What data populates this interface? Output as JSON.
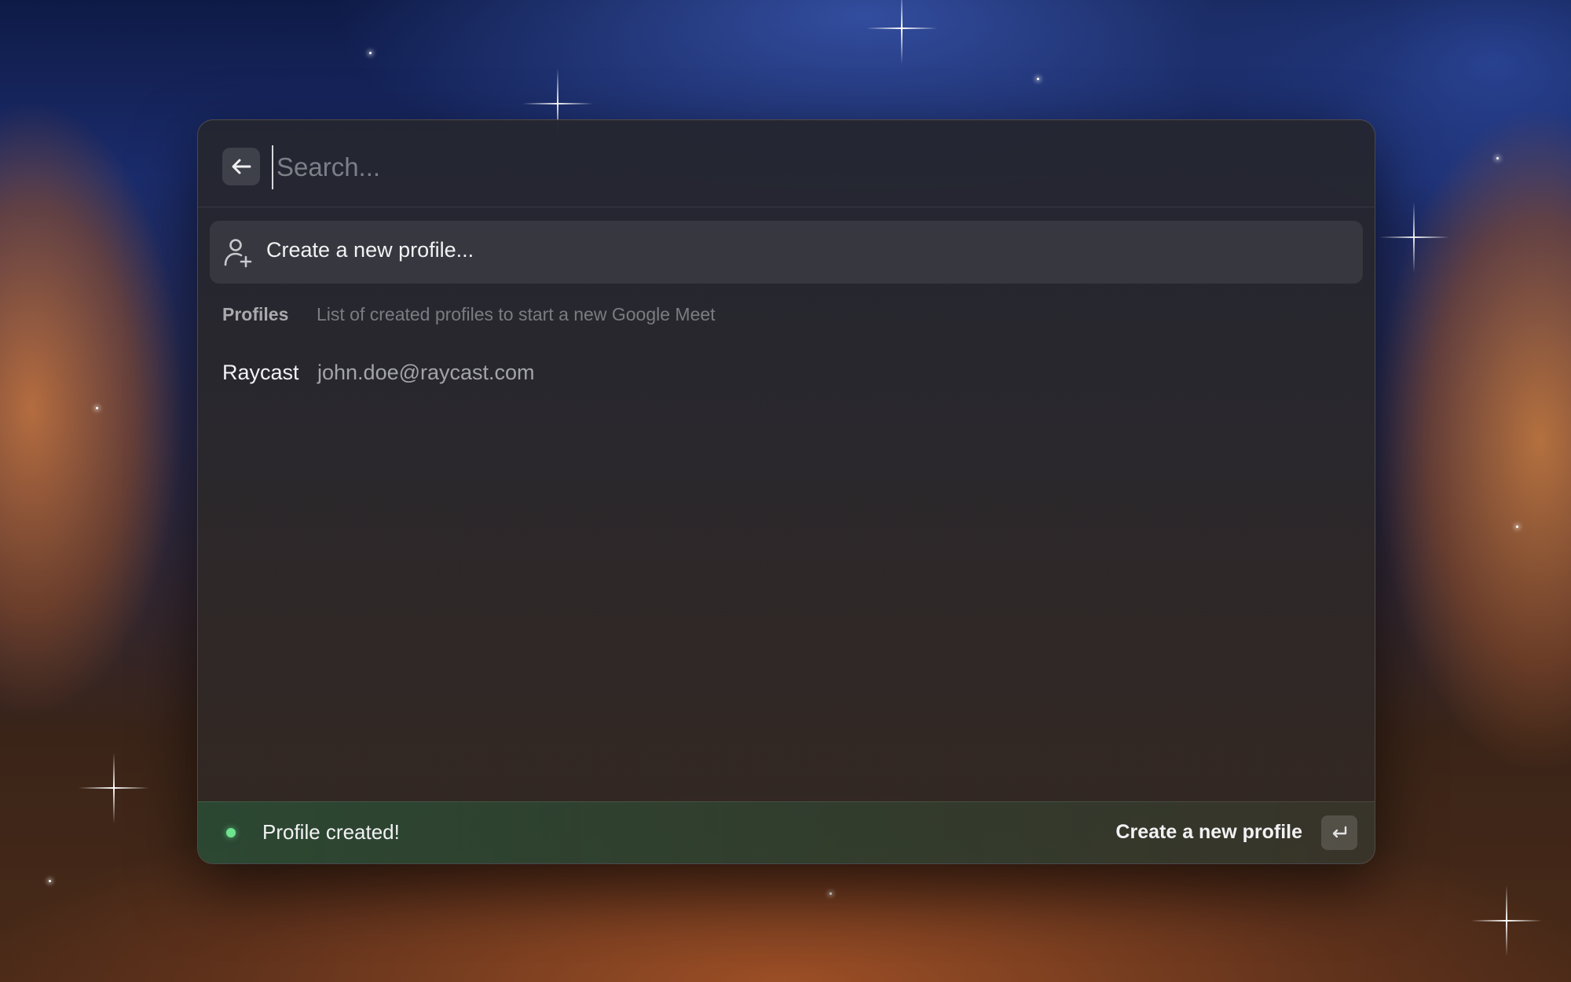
{
  "search": {
    "placeholder": "Search...",
    "value": ""
  },
  "action_row": {
    "icon": "person-add-icon",
    "label": "Create a new profile..."
  },
  "section": {
    "title": "Profiles",
    "subtitle": "List of created profiles to start a new Google Meet"
  },
  "profiles": [
    {
      "title": "Raycast",
      "subtitle": "john.doe@raycast.com"
    }
  ],
  "footer": {
    "toast_icon": "status-dot-icon",
    "toast_color": "#6ee48f",
    "toast": "Profile created!",
    "primary_action": "Create a new profile",
    "shortcut_icon": "return-key-icon"
  },
  "icons": {
    "back": "arrow-left-icon"
  }
}
